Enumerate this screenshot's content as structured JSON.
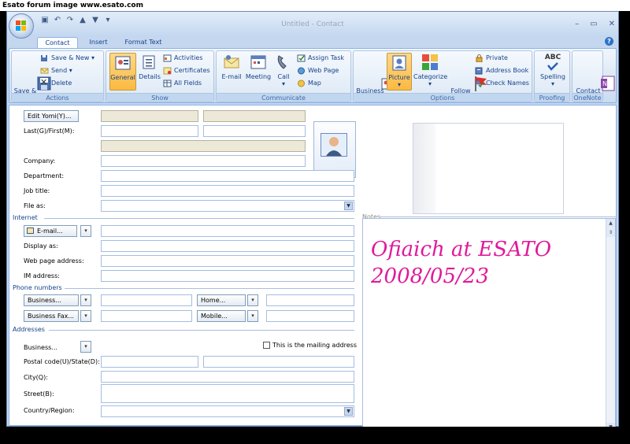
{
  "banner": "Esato forum image www.esato.com",
  "window": {
    "title": "Untitled - Contact",
    "controls": [
      "–",
      "▭",
      "✕"
    ]
  },
  "tabs": {
    "contact": "Contact",
    "insert": "Insert",
    "format_text": "Format Text"
  },
  "ribbon": {
    "actions": {
      "label": "Actions",
      "save_close": "Save &\nClose",
      "save_new": "Save & New",
      "send": "Send",
      "delete": "Delete"
    },
    "show": {
      "label": "Show",
      "general": "General",
      "details": "Details",
      "activities": "Activities",
      "certificates": "Certificates",
      "all_fields": "All Fields"
    },
    "communicate": {
      "label": "Communicate",
      "email": "E-mail",
      "meeting": "Meeting",
      "call": "Call",
      "assign_task": "Assign Task",
      "web_page": "Web Page",
      "map": "Map"
    },
    "options": {
      "label": "Options",
      "business_card": "Business\nCard",
      "picture": "Picture",
      "categorize": "Categorize",
      "follow_up": "Follow\nUp",
      "private": "Private",
      "address_book": "Address Book",
      "check_names": "Check Names"
    },
    "proofing": {
      "label": "Proofing",
      "spelling": "Spelling",
      "spelling_icon_text": "ABC"
    },
    "onenote": {
      "label": "OneNote",
      "contact_notes": "Contact\nNotes"
    }
  },
  "form": {
    "edit_yomi": "Edit Yomi(Y)...",
    "last_first": "Last(G)/First(M):",
    "company": "Company:",
    "department": "Department:",
    "job_title": "Job title:",
    "file_as": "File as:",
    "internet_section": "Internet",
    "email_btn": "E-mail...",
    "display_as": "Display as:",
    "web_page_address": "Web page address:",
    "im_address": "IM address:",
    "phone_section": "Phone numbers",
    "business_phone": "Business...",
    "business_fax": "Business Fax...",
    "home_phone": "Home...",
    "mobile_phone": "Mobile...",
    "addresses_section": "Addresses",
    "business_address": "Business...",
    "mailing_address": "This is the mailing address",
    "postal_code": "Postal code(U)/State(D):",
    "city": "City(Q):",
    "street": "Street(B):",
    "country_region": "Country/Region:",
    "notes_label": "Notes",
    "notes_text": "Ofiaich at ESATO\n2008/05/23"
  }
}
